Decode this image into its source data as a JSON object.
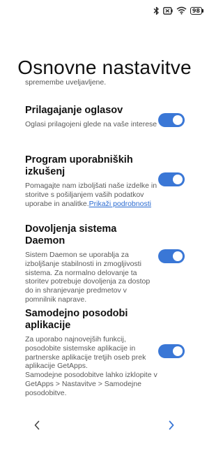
{
  "status_bar": {
    "icons": [
      "bluetooth-icon",
      "battery-saver-icon",
      "wifi-icon"
    ],
    "battery_level": "98"
  },
  "page": {
    "title": "Osnovne nastavitve",
    "intro": "spremembe uveljavljene."
  },
  "settings": [
    {
      "title": "Prilagajanje oglasov",
      "description": "Oglasi prilagojeni glede na vaše interese",
      "enabled": true
    },
    {
      "title": "Program uporabniških izkušenj",
      "description": "Pomagajte nam izboljšati naše izdelke in storitve s pošiljanjem vaših podatkov uporabe in analitke.",
      "link": "Prikaži podrobnosti",
      "enabled": true
    },
    {
      "title": "Dovoljenja sistema Daemon",
      "description": "Sistem Daemon se uporablja za izboljšanje stabilnosti in zmogljivosti sistema. Za normalno delovanje ta storitev potrebuje dovoljenja za dostop do in shranjevanje predmetov v pomnilnik naprave.",
      "enabled": true
    },
    {
      "title": "Samodejno posodobi aplikacije",
      "description": "Za uporabo najnovejših funkcij, posodobite sistemske aplikacije in partnerske aplikacije tretjih oseb prek aplikacije GetApps.\nSamodejne posodobitve lahko izklopite v GetApps > Nastavitve > Samodejne posodobitve.",
      "enabled": true
    }
  ],
  "navigation": {
    "back_icon": "chevron-left-icon",
    "next_icon": "chevron-right-icon",
    "accent_color": "#3a77d6"
  }
}
